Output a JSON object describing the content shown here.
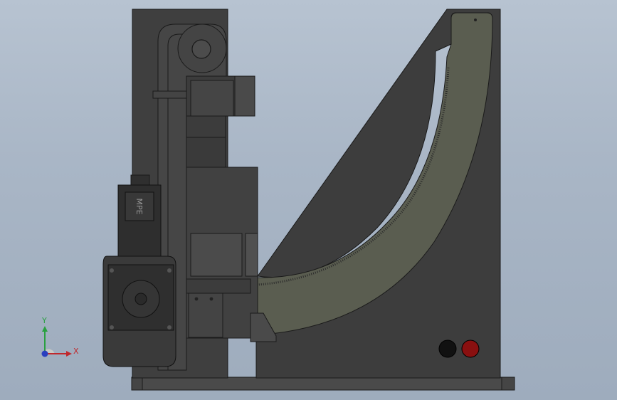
{
  "window": {
    "background_top": "#b7c3d1",
    "background_bottom": "#9eacbd"
  },
  "model": {
    "body_color": "#3e3e3e",
    "body_light": "#4a4a4a",
    "arc_fill": "#5a5d50",
    "edge_color": "#1a1a1a",
    "indicator_left_color": "#111111",
    "indicator_right_color": "#8a1010"
  },
  "motor_label": "MPE",
  "triad": {
    "x_label": "X",
    "y_label": "Y",
    "x_color": "#c0282c",
    "y_color": "#2aa040",
    "z_color": "#2a3fbf"
  }
}
